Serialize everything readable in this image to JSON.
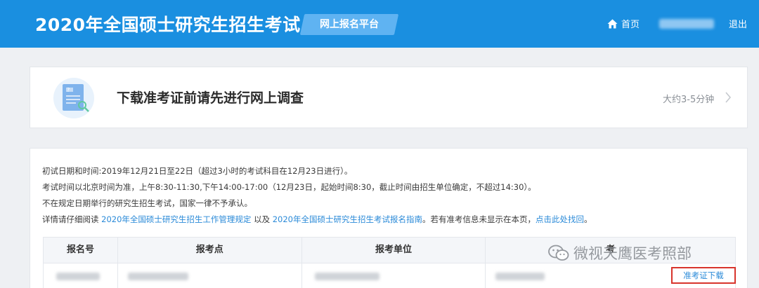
{
  "header": {
    "title": "2020年全国硕士研究生招生考试",
    "platform": "网上报名平台",
    "home": "首页",
    "logout": "退出"
  },
  "survey": {
    "title": "下载准考证前请先进行网上调查",
    "time": "大约3-5分钟"
  },
  "info": {
    "line1": "初试日期和时间:2019年12月21日至22日（超过3小时的考试科目在12月23日进行）。",
    "line2": "考试时间以北京时间为准，上午8:30-11:30,下午14:00-17:00（12月23日，起始时间8:30，截止时间由招生单位确定，不超过14:30）。",
    "line3": "不在规定日期举行的研究生招生考试，国家一律不予承认。",
    "line4_prefix": "详情请仔细阅读",
    "link_rules": "2020年全国硕士研究生招生工作管理规定",
    "and": "以及",
    "link_guide": "2020年全国硕士研究生招生考试报名指南",
    "line4_mid": "。若有准考信息未显示在本页，",
    "link_retrieve": "点击此处找回",
    "line4_end": "。"
  },
  "table": {
    "headers": [
      "报名号",
      "报考点",
      "报考单位",
      "考"
    ]
  },
  "download_label": "准考证下载",
  "watermark": "微视天鹰医考照部",
  "colors": {
    "header_bg": "#1a8fe0",
    "link": "#2a8ad8",
    "highlight_border": "#d8342c"
  }
}
